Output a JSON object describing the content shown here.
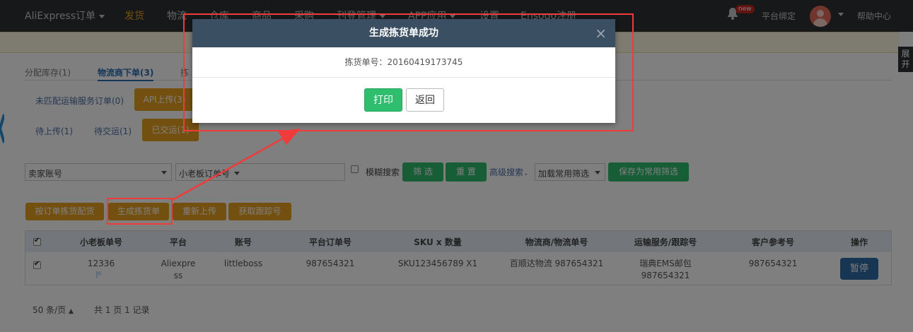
{
  "topnav": {
    "brand": "AliExpress订单",
    "items": [
      "发货",
      "物流",
      "仓库",
      "商品",
      "采购",
      "刊登管理",
      "APP应用",
      "设置",
      "Ensogo注册"
    ],
    "notification_badge": "new",
    "bind_platform": "平台绑定",
    "help": "帮助中心",
    "active_color": "#e8a020"
  },
  "side_tab": {
    "label": "展开"
  },
  "tabs": [
    {
      "label": "分配库存(1)"
    },
    {
      "label": "物流商下单(3)",
      "active": true
    },
    {
      "label": "拣"
    }
  ],
  "filters_row1": {
    "unmatched": "未匹配运输服务订单(0)",
    "api_upload": "API上传(3)"
  },
  "filters_row2": {
    "to_upload": "待上传(1)",
    "to_ship": "待交运(1)",
    "shipped": "已交运(1)"
  },
  "search": {
    "seller_account": "卖家账号",
    "order_no": "小老板订单号",
    "fuzzy": "模糊搜索",
    "filter": "筛 选",
    "reset": "重 置",
    "advanced": "高级搜索",
    "load_common": "加载常用筛选",
    "save_common": "保存为常用筛选"
  },
  "actions": {
    "by_order": "按订单拣货配货",
    "generate": "生成拣货单",
    "reupload": "重新上传",
    "get_tracking": "获取跟踪号"
  },
  "table": {
    "headers": [
      "小老板单号",
      "平台",
      "账号",
      "平台订单号",
      "SKU x 数量",
      "物流商/物流单号",
      "运输服务/跟踪号",
      "客户参考号",
      "操作"
    ],
    "row": {
      "order_no": "12336",
      "platform": "Aliexpress",
      "account": "littleboss",
      "platform_order": "987654321",
      "sku": "SKU123456789 X1",
      "logistics": "百顺达物流 987654321",
      "service": "瑞典EMS邮包",
      "tracking": "987654321",
      "customer_ref": "987654321",
      "action": "暂停"
    }
  },
  "pager": {
    "per_page": "50 条/页",
    "total": "共 1 页 1 记录"
  },
  "modal": {
    "title": "生成拣货单成功",
    "close": "×",
    "pick_no_label": "拣货单号：20160419173745",
    "print": "打印",
    "back": "返回"
  }
}
